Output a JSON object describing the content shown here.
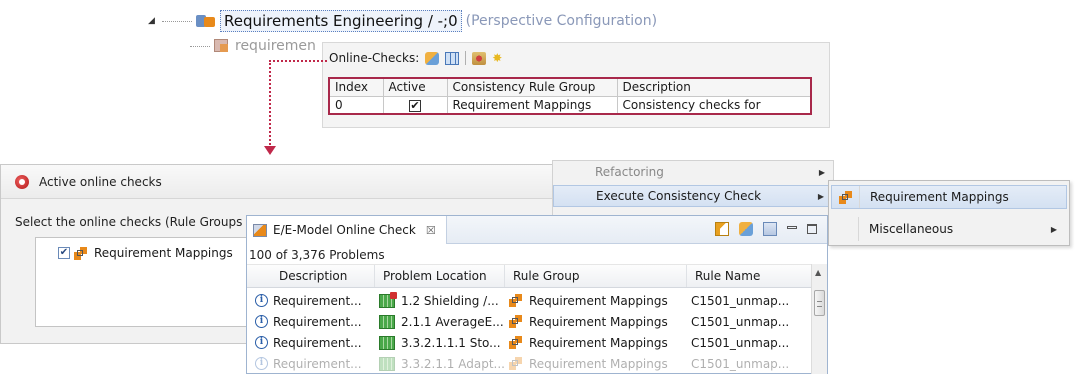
{
  "tree": {
    "root_label": "Requirements Engineering / -;0",
    "root_sub": "(Perspective Configuration)",
    "child_label": "requiremen"
  },
  "online_checks": {
    "toolbar_label": "Online-Checks:",
    "columns": [
      "Index",
      "Active",
      "Consistency Rule Group",
      "Description"
    ],
    "rows": [
      {
        "index": "0",
        "active": "✔",
        "group": "Requirement Mappings",
        "description": "Consistency checks for"
      }
    ]
  },
  "dialog": {
    "title": "Active online checks",
    "prompt": "Select the online checks (Rule Groups",
    "item_checkmark": "✔",
    "item_label": "Requirement Mappings"
  },
  "menu": {
    "items": [
      "Refactoring",
      "Execute Consistency Check"
    ],
    "arrow_glyph": "▶",
    "submenu": [
      "Requirement Mappings",
      "Miscellaneous"
    ]
  },
  "view": {
    "tab_title": "E/E-Model Online Check",
    "close_glyph": "☒",
    "status": "100 of 3,376 Problems",
    "columns": [
      "Description",
      "Problem Location",
      "Rule Group",
      "Rule Name"
    ],
    "info_glyph": "i",
    "scroll_up_glyph": "▲",
    "rows": [
      {
        "description": "Requirement...",
        "location": "1.2 Shielding /...",
        "group": "Requirement Mappings",
        "rule": "C1501_unmap..."
      },
      {
        "description": "Requirement...",
        "location": "2.1.1 AverageE...",
        "group": "Requirement Mappings",
        "rule": "C1501_unmap..."
      },
      {
        "description": "Requirement...",
        "location": "3.3.2.1.1.1 Sto...",
        "group": "Requirement Mappings",
        "rule": "C1501_unmap..."
      },
      {
        "description": "Requirement...",
        "location": "3.3.2.1.1 Adapt...",
        "group": "Requirement Mappings",
        "rule": "C1501_unmap..."
      }
    ]
  },
  "colors": {
    "highlight_border": "#a8284a",
    "connector": "#c0284a",
    "menu_hover": "#d4e1f2",
    "info_icon": "#2a5ea8"
  },
  "icons": {
    "tree": [
      "expand-triangle-icon",
      "perspective-config-icon",
      "requirement-doc-icon"
    ],
    "online_checks_toolbar": [
      "sync-icon",
      "table-icon",
      "filter-icon",
      "star-icon"
    ],
    "view_toolbar": [
      "run-check-icon",
      "sync-icon",
      "filter-icon",
      "minimize-icon",
      "maximize-icon"
    ]
  }
}
